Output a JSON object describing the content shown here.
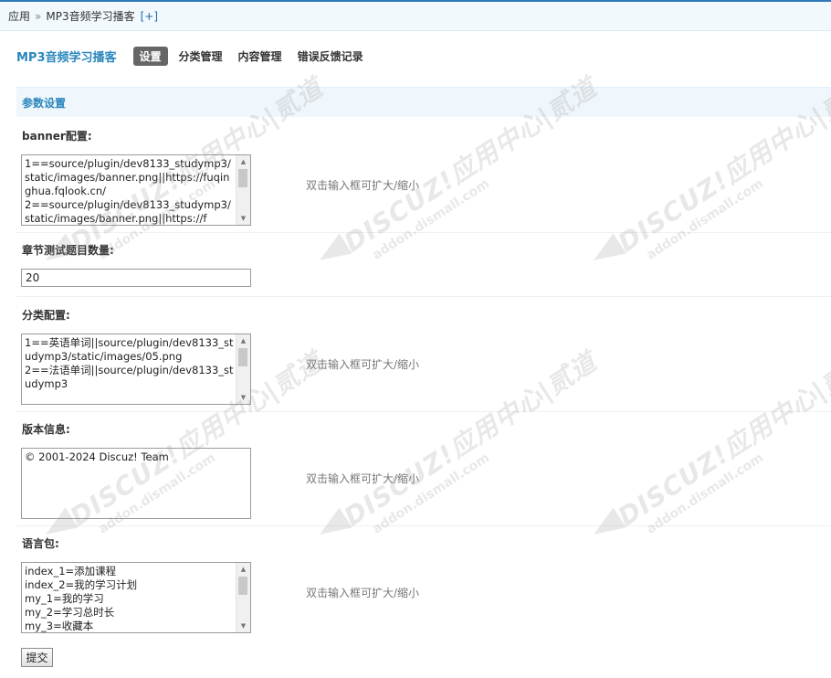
{
  "breadcrumb": {
    "root": "应用",
    "separator": "»",
    "current": "MP3音频学习播客",
    "add_label": "[+]"
  },
  "app_title": "MP3音频学习播客",
  "nav": {
    "items": [
      {
        "label": "设置",
        "active": true
      },
      {
        "label": "分类管理",
        "active": false
      },
      {
        "label": "内容管理",
        "active": false
      },
      {
        "label": "错误反馈记录",
        "active": false
      }
    ]
  },
  "section_title": "参数设置",
  "fields": {
    "banner": {
      "label": "banner配置:",
      "value": "1==source/plugin/dev8133_studymp3/static/images/banner.png||https://fuqinghua.fqlook.cn/\n2==source/plugin/dev8133_studymp3/static/images/banner.png||https://f",
      "tip": "双击输入框可扩大/缩小"
    },
    "chapter_count": {
      "label": "章节测试题目数量:",
      "value": "20"
    },
    "category": {
      "label": "分类配置:",
      "value": "1==英语单词||source/plugin/dev8133_studymp3/static/images/05.png\n2==法语单词||source/plugin/dev8133_studymp3",
      "tip": "双击输入框可扩大/缩小"
    },
    "version": {
      "label": "版本信息:",
      "value": "© 2001-2024 Discuz! Team",
      "tip": "双击输入框可扩大/缩小"
    },
    "lang": {
      "label": "语言包:",
      "value": "index_1=添加课程\nindex_2=我的学习计划\nmy_1=我的学习\nmy_2=学习总时长\nmy_3=收藏本",
      "tip": "双击输入框可扩大/缩小"
    }
  },
  "submit_label": "提交",
  "watermark": {
    "brand": "DISCUZ!应用中心|贰道",
    "domain": "addon.dismall.com"
  },
  "colors": {
    "accent": "#2a87bd",
    "section_bg": "#f0f7fc",
    "topbar_bg": "#f2f9fd"
  }
}
